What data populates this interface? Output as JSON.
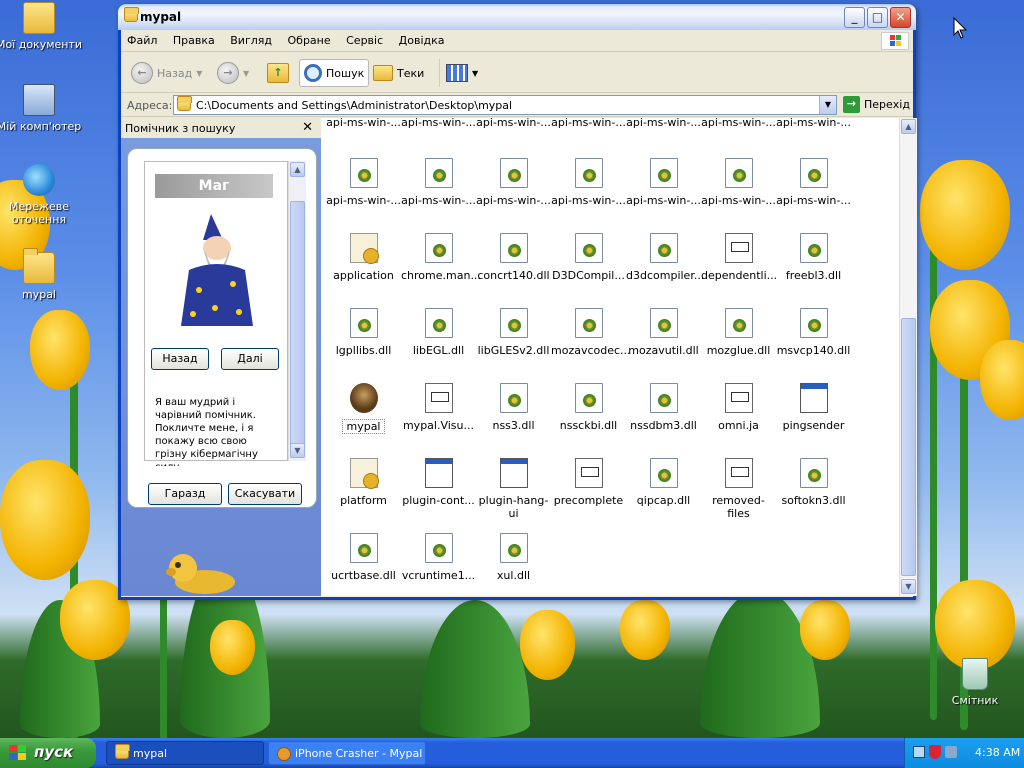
{
  "desktop": {
    "icons": [
      {
        "label": "Мої документи",
        "icon": "my-documents-icon"
      },
      {
        "label": "Мій комп'ютер",
        "icon": "my-computer-icon"
      },
      {
        "label": "Мережеве оточення",
        "icon": "network-places-icon"
      },
      {
        "label": "mypal",
        "icon": "folder-icon"
      },
      {
        "label": "Смітник",
        "icon": "recycle-bin-icon"
      }
    ]
  },
  "window": {
    "title": "mypal",
    "menu": [
      "Файл",
      "Правка",
      "Вигляд",
      "Обране",
      "Сервіс",
      "Довідка"
    ],
    "toolbar": {
      "back": "Назад",
      "search": "Пошук",
      "folders": "Теки"
    },
    "address": {
      "label": "Адреса:",
      "path": "C:\\Documents and Settings\\Administrator\\Desktop\\mypal",
      "go": "Перехід"
    },
    "search_pane": {
      "header": "Помічник з пошуку",
      "character": "Маг",
      "back_button": "Назад",
      "next_button": "Далі",
      "message": "Я ваш мудрий і чарівний помічник. Покличте мене, і я покажу всю свою грізну кібермагічну силу",
      "ok_button": "Гаразд",
      "cancel_button": "Скасувати"
    },
    "files": [
      {
        "name": "api-ms-win-...",
        "type": "dll"
      },
      {
        "name": "api-ms-win-...",
        "type": "dll"
      },
      {
        "name": "api-ms-win-...",
        "type": "dll"
      },
      {
        "name": "api-ms-win-...",
        "type": "dll"
      },
      {
        "name": "api-ms-win-...",
        "type": "dll"
      },
      {
        "name": "api-ms-win-...",
        "type": "dll"
      },
      {
        "name": "api-ms-win-...",
        "type": "dll"
      },
      {
        "name": "api-ms-win-...",
        "type": "dll"
      },
      {
        "name": "api-ms-win-...",
        "type": "dll"
      },
      {
        "name": "api-ms-win-...",
        "type": "dll"
      },
      {
        "name": "api-ms-win-...",
        "type": "dll"
      },
      {
        "name": "api-ms-win-...",
        "type": "dll"
      },
      {
        "name": "api-ms-win-...",
        "type": "dll"
      },
      {
        "name": "api-ms-win-...",
        "type": "dll"
      },
      {
        "name": "application",
        "type": "settings"
      },
      {
        "name": "chrome.man...",
        "type": "dll"
      },
      {
        "name": "concrt140.dll",
        "type": "dll"
      },
      {
        "name": "D3DCompil...",
        "type": "dll"
      },
      {
        "name": "d3dcompiler...",
        "type": "dll"
      },
      {
        "name": "dependentli...",
        "type": "doc"
      },
      {
        "name": "freebl3.dll",
        "type": "dll"
      },
      {
        "name": "lgpllibs.dll",
        "type": "dll"
      },
      {
        "name": "libEGL.dll",
        "type": "dll"
      },
      {
        "name": "libGLESv2.dll",
        "type": "dll"
      },
      {
        "name": "mozavcodec...",
        "type": "dll"
      },
      {
        "name": "mozavutil.dll",
        "type": "dll"
      },
      {
        "name": "mozglue.dll",
        "type": "dll"
      },
      {
        "name": "msvcp140.dll",
        "type": "dll"
      },
      {
        "name": "mypal",
        "type": "exe"
      },
      {
        "name": "mypal.Visu...",
        "type": "manifest"
      },
      {
        "name": "nss3.dll",
        "type": "dll"
      },
      {
        "name": "nssckbi.dll",
        "type": "dll"
      },
      {
        "name": "nssdbm3.dll",
        "type": "dll"
      },
      {
        "name": "omni.ja",
        "type": "doc"
      },
      {
        "name": "pingsender",
        "type": "app"
      },
      {
        "name": "platform",
        "type": "settings"
      },
      {
        "name": "plugin-cont...",
        "type": "app"
      },
      {
        "name": "plugin-hang-ui",
        "type": "app"
      },
      {
        "name": "precomplete",
        "type": "doc"
      },
      {
        "name": "qipcap.dll",
        "type": "dll"
      },
      {
        "name": "removed-files",
        "type": "doc"
      },
      {
        "name": "softokn3.dll",
        "type": "dll"
      },
      {
        "name": "ucrtbase.dll",
        "type": "dll"
      },
      {
        "name": "vcruntime1...",
        "type": "dll"
      },
      {
        "name": "xul.dll",
        "type": "dll"
      }
    ]
  },
  "taskbar": {
    "start": "пуск",
    "tasks": [
      {
        "label": "mypal",
        "active": true
      },
      {
        "label": "iPhone Crasher - Mypal",
        "active": false
      }
    ],
    "clock": "4:38 AM"
  }
}
